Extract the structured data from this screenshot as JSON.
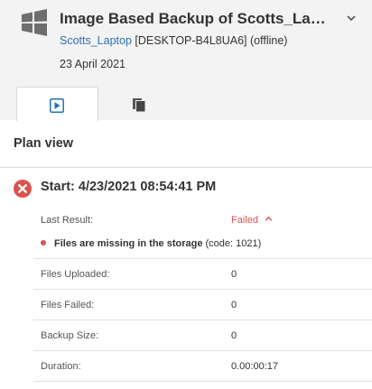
{
  "header": {
    "title": "Image Based Backup of Scotts_Laptop",
    "device_link": "Scotts_Laptop",
    "device_info": "[DESKTOP-B4L8UA6] (offline)",
    "date": "23 April 2021",
    "logo_icon": "windows-logo-icon",
    "collapse_icon": "chevron-down-icon"
  },
  "tabs": [
    {
      "name": "plan-view",
      "icon": "play-icon",
      "active": true
    },
    {
      "name": "copy",
      "icon": "copy-icon",
      "active": false
    }
  ],
  "plan_view": {
    "title": "Plan view",
    "start_label": "Start: 4/23/2021 08:54:41 PM",
    "status_icon": "error-circle-icon",
    "last_result_label": "Last Result:",
    "last_result_value": "Failed",
    "error_message_bold": "Files are missing in the storage",
    "error_code": " (code: 1021)",
    "rows": [
      {
        "label": "Files Uploaded:",
        "value": "0"
      },
      {
        "label": "Files Failed:",
        "value": "0"
      },
      {
        "label": "Backup Size:",
        "value": "0"
      },
      {
        "label": "Duration:",
        "value": "0.00:00:17"
      }
    ]
  },
  "colors": {
    "accent": "#1e73be",
    "error": "#d9534f",
    "link": "#2e6fb4",
    "header_bg": "#f3f3f3"
  }
}
